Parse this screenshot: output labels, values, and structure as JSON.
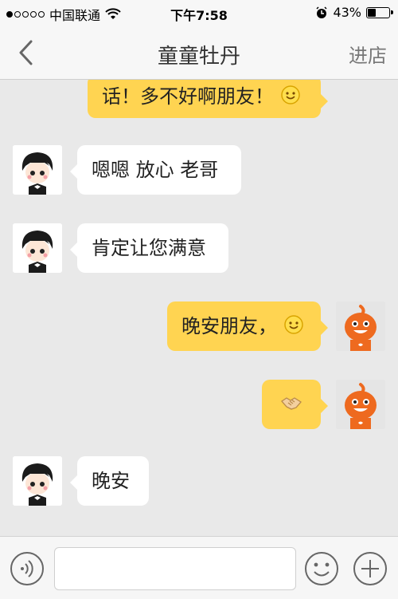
{
  "status_bar": {
    "carrier": "中国联通",
    "time": "下午7:58",
    "battery_percent": "43%",
    "battery_level": 0.43,
    "icons": [
      "signal-dots",
      "wifi-icon",
      "alarm-icon",
      "battery-icon"
    ]
  },
  "nav": {
    "title": "童童牡丹",
    "right_label": "进店",
    "back_icon": "chevron-left-icon"
  },
  "messages": [
    {
      "side": "right",
      "text": "话！多不好啊朋友！",
      "emoji": "smile-emoji"
    },
    {
      "side": "left",
      "text": "嗯嗯 放心 老哥"
    },
    {
      "side": "left",
      "text": "肯定让您满意"
    },
    {
      "side": "right",
      "text": "晚安朋友，",
      "emoji": "smile-emoji"
    },
    {
      "side": "right",
      "text": "",
      "emoji": "handshake-emoji"
    },
    {
      "side": "left",
      "text": "晚安"
    }
  ],
  "input_bar": {
    "text_value": "",
    "voice_icon": "voice-icon",
    "emoji_icon": "emoji-icon",
    "plus_icon": "plus-icon"
  },
  "colors": {
    "bubble_right": "#ffd451",
    "bubble_left": "#ffffff",
    "background": "#e9e9e9",
    "robot_avatar": "#ee6a1f"
  }
}
